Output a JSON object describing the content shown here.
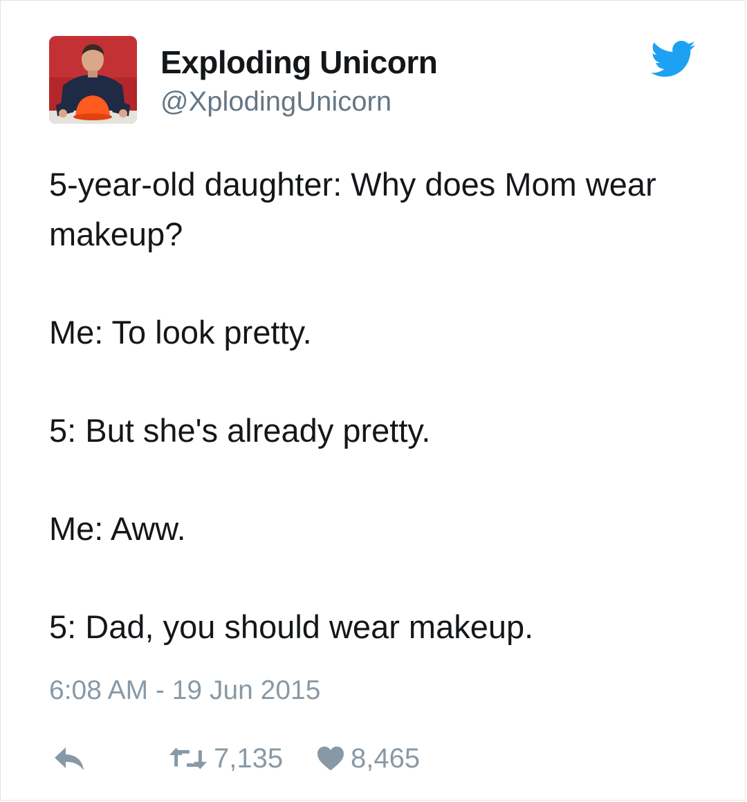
{
  "user": {
    "display_name": "Exploding Unicorn",
    "handle": "@XplodingUnicorn"
  },
  "tweet": {
    "lines": [
      "5-year-old daughter: Why does Mom wear makeup?",
      "Me: To look pretty.",
      "5: But she's already pretty.",
      "Me: Aww.",
      "5: Dad, you should wear makeup."
    ],
    "timestamp": "6:08 AM - 19 Jun 2015"
  },
  "actions": {
    "reply_icon": "reply-icon",
    "retweet_icon": "retweet-icon",
    "retweet_count": "7,135",
    "like_icon": "heart-icon",
    "like_count": "8,465"
  },
  "colors": {
    "twitter_blue": "#1da1f2",
    "secondary_text": "#8899a6",
    "primary_text": "#14171a"
  }
}
